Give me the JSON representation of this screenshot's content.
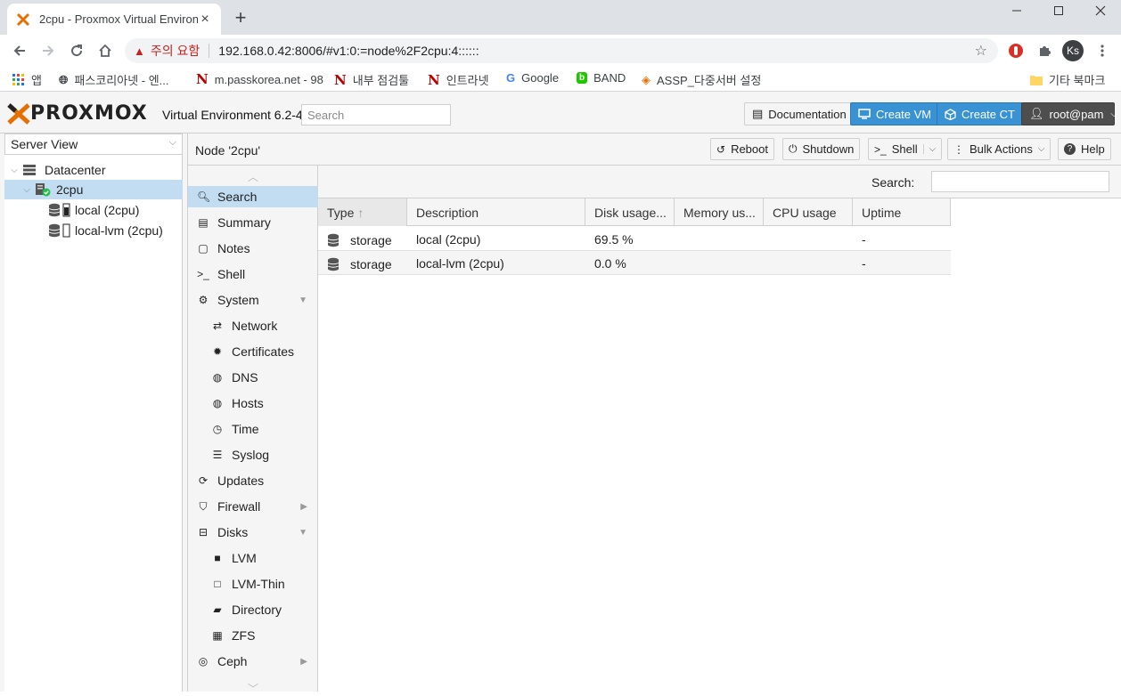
{
  "browser": {
    "tab_title": "2cpu - Proxmox Virtual Environm",
    "warning_text": "주의 요함",
    "url": "192.168.0.42:8006/#v1:0:=node%2F2cpu:4::::::",
    "profile_initials": "Ks",
    "bookmarks": [
      {
        "label": "앱",
        "icon": "apps-grid-icon"
      },
      {
        "label": "패스코리아넷 - 엔...",
        "icon": "globe-icon"
      },
      {
        "label": "m.passkorea.net - 98",
        "icon": "n-logo-icon"
      },
      {
        "label": "내부 점검툴",
        "icon": "n-logo-icon"
      },
      {
        "label": "인트라넷",
        "icon": "n-logo-icon"
      },
      {
        "label": "Google",
        "icon": "google-icon"
      },
      {
        "label": "BAND",
        "icon": "band-icon"
      },
      {
        "label": "ASSP_다중서버 설정",
        "icon": "assp-icon"
      },
      {
        "label": "기타 북마크",
        "icon": "folder-icon"
      }
    ]
  },
  "header": {
    "logo": "PROXMOX",
    "version": "Virtual Environment 6.2-4",
    "search_placeholder": "Search",
    "documentation": "Documentation",
    "create_vm": "Create VM",
    "create_ct": "Create CT",
    "user": "root@pam"
  },
  "left": {
    "view": "Server View",
    "tree": [
      {
        "label": "Datacenter",
        "icon": "datacenter-icon"
      },
      {
        "label": "2cpu",
        "icon": "node-online-icon"
      },
      {
        "label": "local (2cpu)",
        "icon": "storage-icon"
      },
      {
        "label": "local-lvm (2cpu)",
        "icon": "storage-icon"
      }
    ]
  },
  "node": {
    "title": "Node '2cpu'",
    "reboot": "Reboot",
    "shutdown": "Shutdown",
    "shell": "Shell",
    "bulk_actions": "Bulk Actions",
    "help": "Help"
  },
  "menu": [
    {
      "label": "Search",
      "icon": "search-icon"
    },
    {
      "label": "Summary",
      "icon": "book-icon"
    },
    {
      "label": "Notes",
      "icon": "notes-icon"
    },
    {
      "label": "Shell",
      "icon": "terminal-icon"
    },
    {
      "label": "System",
      "icon": "cogs-icon"
    },
    {
      "label": "Network",
      "icon": "exchange-icon"
    },
    {
      "label": "Certificates",
      "icon": "certificate-icon"
    },
    {
      "label": "DNS",
      "icon": "globe-icon"
    },
    {
      "label": "Hosts",
      "icon": "globe-icon"
    },
    {
      "label": "Time",
      "icon": "clock-icon"
    },
    {
      "label": "Syslog",
      "icon": "list-icon"
    },
    {
      "label": "Updates",
      "icon": "refresh-icon"
    },
    {
      "label": "Firewall",
      "icon": "shield-icon"
    },
    {
      "label": "Disks",
      "icon": "hdd-icon"
    },
    {
      "label": "LVM",
      "icon": "square-icon"
    },
    {
      "label": "LVM-Thin",
      "icon": "square-outline-icon"
    },
    {
      "label": "Directory",
      "icon": "folder-icon"
    },
    {
      "label": "ZFS",
      "icon": "th-large-icon"
    },
    {
      "label": "Ceph",
      "icon": "ceph-icon"
    }
  ],
  "grid": {
    "search_label": "Search:",
    "columns": [
      "Type",
      "Description",
      "Disk usage...",
      "Memory us...",
      "CPU usage",
      "Uptime"
    ],
    "rows": [
      {
        "type": "storage",
        "description": "local (2cpu)",
        "disk": "69.5 %",
        "memory": "",
        "cpu": "",
        "uptime": "-"
      },
      {
        "type": "storage",
        "description": "local-lvm (2cpu)",
        "disk": "0.0 %",
        "memory": "",
        "cpu": "",
        "uptime": "-"
      }
    ]
  },
  "colors": {
    "accent_orange": "#e57000",
    "button_blue": "#3892d4",
    "selection": "#c2ddf2",
    "warning_red": "#c5221f"
  }
}
